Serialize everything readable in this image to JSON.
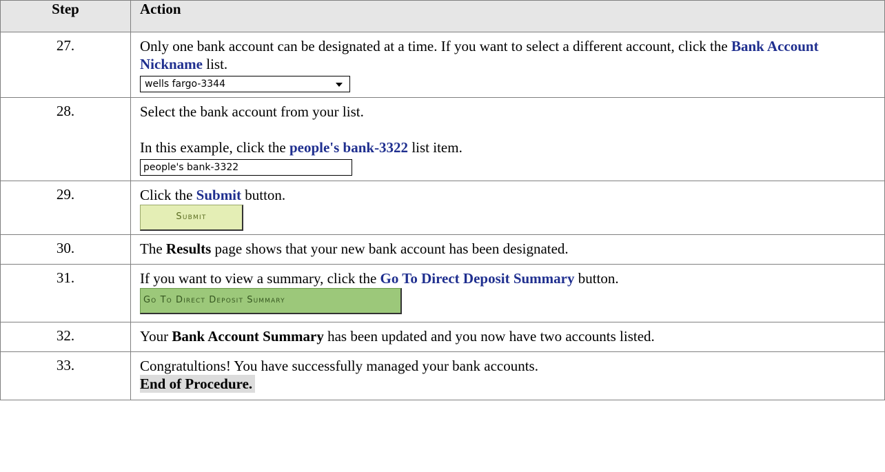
{
  "header": {
    "step": "Step",
    "action": "Action"
  },
  "rows": [
    {
      "num": "27.",
      "text_a": "Only one bank account can be designated at a time. If you want to select a different account, click the ",
      "bold": "Bank Account Nickname",
      "text_b": " list.",
      "select_value": "wells fargo-3344"
    },
    {
      "num": "28.",
      "text1": "Select the bank account from your list.",
      "text_a": "In this example, click the ",
      "bold": "people's bank-3322",
      "text_b": " list item.",
      "list_item": "people's bank-3322"
    },
    {
      "num": "29.",
      "text_a": "Click the ",
      "bold": "Submit",
      "text_b": " button.",
      "button": "Submit"
    },
    {
      "num": "30.",
      "text_a": "The ",
      "bold": "Results",
      "text_b": " page shows that your new bank account has been designated."
    },
    {
      "num": "31.",
      "text_a": "If you want to view a summary, click the ",
      "bold": "Go To Direct Deposit Summary",
      "text_b": " button.",
      "button": "Go To Direct Deposit Summary"
    },
    {
      "num": "32.",
      "text_a": "Your ",
      "bold": "Bank Account Summary",
      "text_b": " has been updated and you now have two accounts listed."
    },
    {
      "num": "33.",
      "text1": "Congratultions! You have successfully managed your bank accounts.",
      "end": "End of Procedure."
    }
  ]
}
